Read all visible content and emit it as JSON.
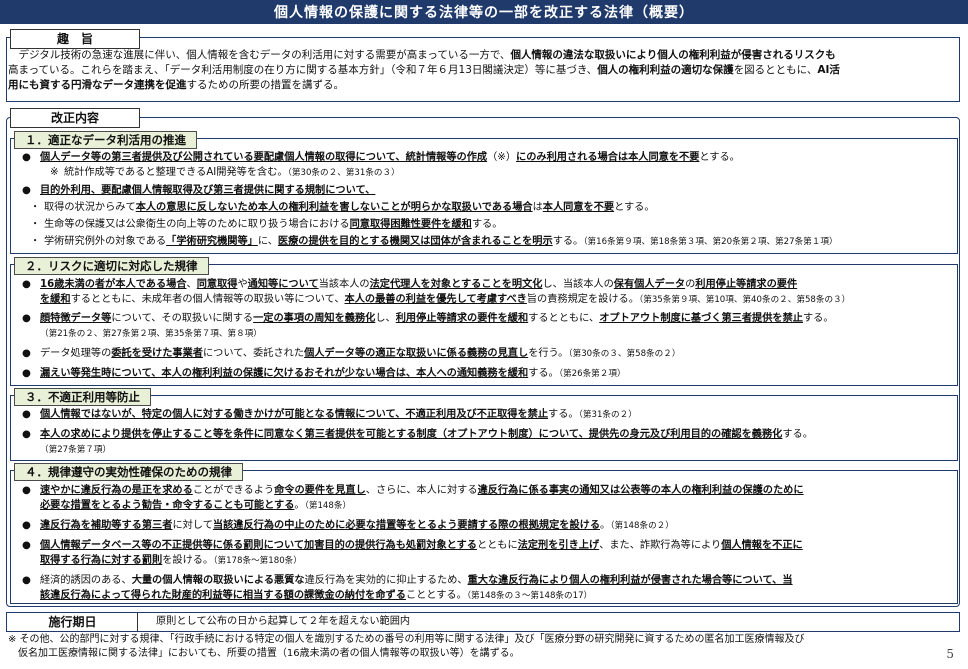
{
  "title": "個人情報の保護に関する法律等の一部を改正する法律（概要）",
  "purpose": {
    "label": "趣　旨",
    "text_1": "デジタル技術の急速な進展に伴い、個人情報を含むデータの利活用に対する需要が高まっている一方で、",
    "text_1b": "個人情報の違法な取扱いにより個人の権利利益が侵害されるリスクも",
    "text_2a": "高まっている。これらを踏まえ、「データ利活用制度の在り方に関する基本方針」（令和７年６月13日閣議決定）等に基づき、",
    "text_2b": "個人の権利利益の適切な保護",
    "text_2c": "を図るとともに、",
    "text_2d": "AI活",
    "text_3a": "用にも資する円滑なデータ連携を促進",
    "text_3b": "するための所要の措置を講ずる。"
  },
  "reform_label": "改正内容",
  "sections": [
    {
      "head": "１．適正なデータ利活用の推進",
      "lines": [
        [
          "●",
          "個人データ等の第三者提供及び公開されている要配慮個人情報の取得について、統計情報等の作成",
          "（※）",
          "にのみ利用される場合は本人同意を不要",
          "とする。"
        ],
        [
          "※",
          "統計作成等であると整理できるAI開発等を含む。",
          "（第30条の２、第31条の３）"
        ],
        [
          "●",
          "目的外利用、要配慮個人情報取得及び第三者提供に関する規制について、"
        ],
        [
          "・",
          "取得の状況からみて",
          "本人の意思に反しないため本人の権利利益を害しないことが明らかな取扱いである場合",
          "は",
          "本人同意を不要",
          "とする。"
        ],
        [
          "・",
          "生命等の保護又は公衆衛生の向上等のために取り扱う場合における",
          "同意取得困難性要件を緩和",
          "する。"
        ],
        [
          "・",
          "学術研究例外の対象である",
          "「学術研究機関等」",
          "に、",
          "医療の提供を目的とする機関又は団体が含まれることを明示",
          "する。",
          "（第16条第９項、第18条第３項、第20条第２項、第27条第１項）"
        ]
      ]
    },
    {
      "head": "２．リスクに適切に対応した規律",
      "lines": [
        [
          "●",
          "16歳未満の者が本人である場合",
          "、",
          "同意取得",
          "や",
          "通知等について",
          "当該本人の",
          "法定代理人を対象とすることを明文化",
          "し、当該本人の",
          "保有個人データ",
          "の",
          "利用停止等請求の要件"
        ],
        [
          "",
          "を緩和",
          "するとともに、未成年者の個人情報等の取扱い等について、",
          "本人の最善の利益を優先して考慮すべき",
          "旨の責務規定を設ける。",
          "（第35条第９項、第10項、第40条の２、第58条の３）"
        ],
        [
          "●",
          "顔特徴データ等",
          "について、その取扱いに関する",
          "一定の事項の周知を義務化",
          "し、",
          "利用停止等請求の要件を緩和",
          "するとともに、",
          "オプトアウト制度に基づく第三者提供を禁止",
          "する。"
        ],
        [
          "",
          "（第21条の２、第27条第２項、第35条第７項、第８項）"
        ],
        [
          "●",
          "データ処理等の",
          "委託を受けた事業者",
          "について、委託された",
          "個人データ等の適正な取扱いに係る義務の見直し",
          "を行う。",
          "（第30条の３、第58条の２）"
        ],
        [
          "●",
          "漏えい等発生時について、本人の権利利益の保護に欠けるおそれが少ない場合は、本人への通知義務を緩和",
          "する。",
          "（第26条第２項）"
        ]
      ]
    },
    {
      "head": "３．不適正利用等防止",
      "lines": [
        [
          "●",
          "個人情報ではないが、特定の個人に対する働きかけが可能となる情報について、不適正利用及び不正取得を禁止",
          "する。",
          "（第31条の２）"
        ],
        [
          "●",
          "本人の求めにより提供を停止すること等を条件に同意なく第三者提供を可能とする制度（オプトアウト制度）について、提供先の身元及び利用目的の確認を義務化",
          "する。"
        ],
        [
          "",
          "（第27条第７項）"
        ]
      ]
    },
    {
      "head": "４．規律遵守の実効性確保のための規律",
      "lines": [
        [
          "●",
          "速やかに違反行為の是正を求める",
          "ことができるよう",
          "命令の要件を見直し",
          "、さらに、本人に対する",
          "違反行為に係る事実の通知又は公表等の本人の権利利益の保護のために"
        ],
        [
          "",
          "必要な措置をとるよう勧告・命令することも可能とする",
          "。",
          "（第148条）"
        ],
        [
          "●",
          "違反行為を補助等する第三者",
          "に対して",
          "当該違反行為の中止のために必要な措置等をとるよう要請する際の根拠規定を設ける",
          "。",
          "（第148条の２）"
        ],
        [
          "●",
          "個人情報データベース等の不正提供等に係る罰則について加害目的の提供行為も処罰対象とする",
          "とともに",
          "法定刑を引き上げ",
          "、また、詐欺行為等により",
          "個人情報を不正に"
        ],
        [
          "",
          "取得する行為に対する罰則",
          "を設ける。",
          "（第178条〜第180条）"
        ],
        [
          "●",
          "経済的誘因のある、",
          "大量の個人情報の取扱いによる悪質な",
          "違反行為を実効的に抑止するため、",
          "重大な違反行為により個人の権利利益が侵害された場合等について、当"
        ],
        [
          "",
          "該違反行為によって得られた財産的利益等に相当する額の課徴金の納付を命ずる",
          "こととする。",
          "（第148条の３〜第148条の17）"
        ]
      ]
    }
  ],
  "effective": {
    "label": "施行期日",
    "text": "原則として公布の日から起算して２年を超えない範囲内"
  },
  "note": {
    "line1": "※ その他、公的部門に対する規律、「行政手続における特定の個人を識別するための番号の利用等に関する法律」及び「医療分野の研究開発に資するための匿名加工医療情報及び",
    "line2": "仮名加工医療情報に関する法律」においても、所要の措置（16歳未満の者の個人情報等の取扱い等）を講ずる。"
  },
  "page_number": "5",
  "colors": {
    "navy": "#1f3a6b",
    "section_head_bg": "#e8f0d8"
  }
}
